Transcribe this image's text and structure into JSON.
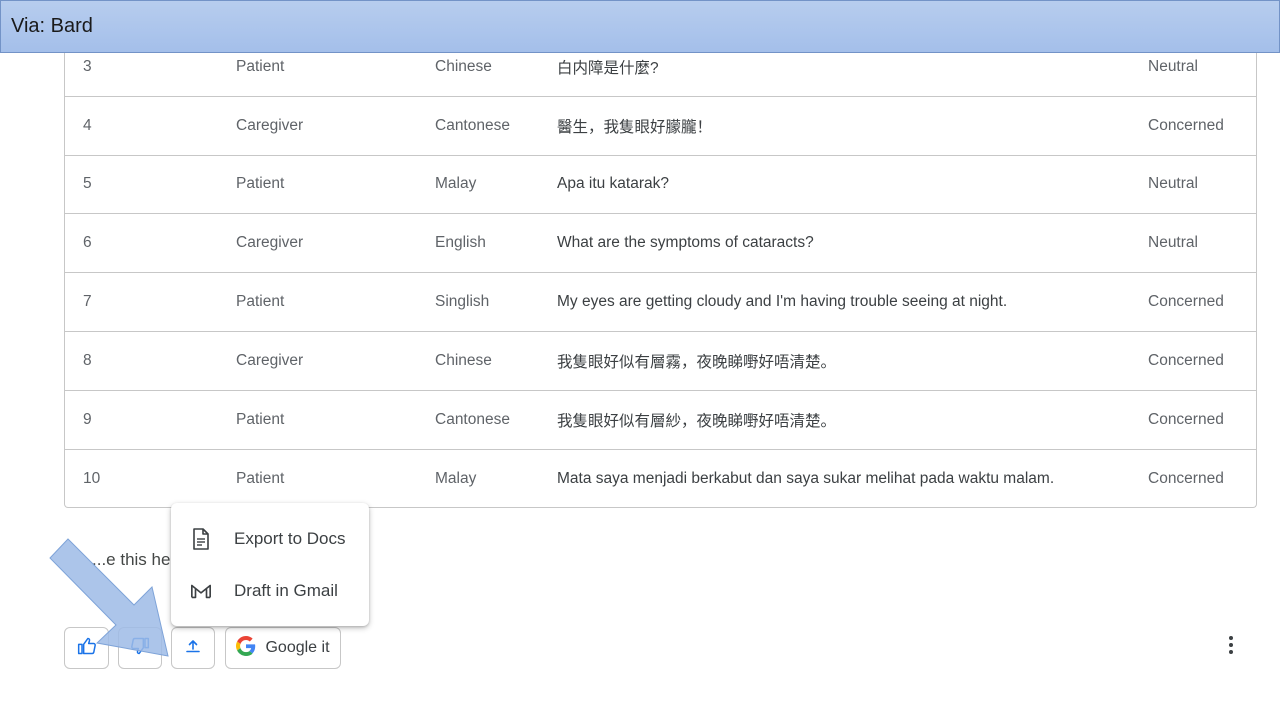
{
  "banner": {
    "title": "Via: Bard"
  },
  "table": {
    "rows": [
      {
        "id": "3",
        "role": "Patient",
        "language": "Chinese",
        "text": "白内障是什麼?",
        "sentiment": "Neutral"
      },
      {
        "id": "4",
        "role": "Caregiver",
        "language": "Cantonese",
        "text": "醫生，我隻眼好朦朧！",
        "sentiment": "Concerned"
      },
      {
        "id": "5",
        "role": "Patient",
        "language": "Malay",
        "text": "Apa itu katarak?",
        "sentiment": "Neutral"
      },
      {
        "id": "6",
        "role": "Caregiver",
        "language": "English",
        "text": "What are the symptoms of cataracts?",
        "sentiment": "Neutral"
      },
      {
        "id": "7",
        "role": "Patient",
        "language": "Singlish",
        "text": "My eyes are getting cloudy and I'm having trouble seeing at night.",
        "sentiment": "Concerned"
      },
      {
        "id": "8",
        "role": "Caregiver",
        "language": "Chinese",
        "text": "我隻眼好似有層霧，夜晚睇嘢好唔清楚。",
        "sentiment": "Concerned"
      },
      {
        "id": "9",
        "role": "Patient",
        "language": "Cantonese",
        "text": "我隻眼好似有層紗，夜晚睇嘢好唔清楚。",
        "sentiment": "Concerned"
      },
      {
        "id": "10",
        "role": "Patient",
        "language": "Malay",
        "text": "Mata saya menjadi berkabut dan saya sukar melihat pada waktu malam.",
        "sentiment": "Concerned"
      }
    ]
  },
  "response": {
    "partial_text": "...e this he..."
  },
  "export_menu": {
    "items": [
      {
        "label": "Export to Docs",
        "icon": "document-icon"
      },
      {
        "label": "Draft in Gmail",
        "icon": "gmail-icon"
      }
    ]
  },
  "actions": {
    "thumbs_up_icon": "thumbs-up-icon",
    "thumbs_down_icon": "thumbs-down-icon",
    "share_icon": "share-export-icon",
    "google_it_label": "Google it",
    "more_icon": "more-vertical-icon"
  },
  "colors": {
    "banner_bg": "#a4bfea",
    "arrow_fill": "#9dbbe6",
    "border": "#c7c7c7",
    "google_blue": "#4285F4",
    "google_red": "#EA4335",
    "google_yellow": "#FBBC05",
    "google_green": "#34A853"
  }
}
